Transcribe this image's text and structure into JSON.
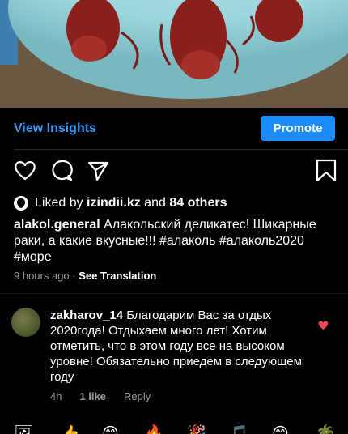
{
  "post": {
    "photo_alt_icon": "crayfish-photo",
    "insights_label": "View Insights",
    "promote_label": "Promote"
  },
  "actions": {
    "like_icon": "heart-outline-icon",
    "comment_icon": "comment-icon",
    "share_icon": "send-icon",
    "save_icon": "bookmark-icon"
  },
  "likes": {
    "prefix": "Liked by",
    "user": "izindii.kz",
    "middle": "and",
    "others": "84 others"
  },
  "caption": {
    "username": "alakol.general",
    "text": "Алакольский деликатес! Шикарные раки, а какие вкусные!!! #алаколь #алаколь2020 #море"
  },
  "meta": {
    "time": "9 hours ago",
    "dot": "·",
    "see_translation": "See Translation"
  },
  "comment": {
    "username": "zakharov_14",
    "text": "Благодарим Вас за отдых 2020года! Отдыхаем много лет! Хотим отметить, что в этом году  все на высоком уровне! Обязательно приедем в следующем году",
    "time": "4h",
    "likes": "1 like",
    "reply": "Reply",
    "liked_color": "#ed4956"
  },
  "emoji_bar": [
    "🖼",
    "👍",
    "😊",
    "🔥",
    "🎉",
    "🎵",
    "😊",
    "🌴"
  ]
}
